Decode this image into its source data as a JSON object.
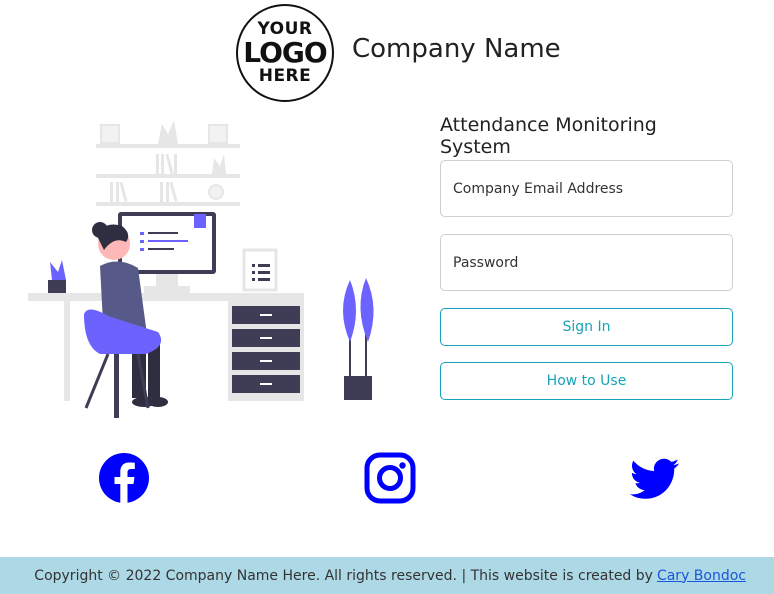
{
  "header": {
    "logo_text": [
      "YOUR",
      "LOGO",
      "HERE"
    ],
    "company_name": "Company Name"
  },
  "form": {
    "title": "Attendance Monitoring System",
    "email_placeholder": "Company Email Address",
    "password_placeholder": "Password",
    "sign_in_label": "Sign In",
    "how_to_use_label": "How to Use"
  },
  "social": {
    "icons": [
      "facebook-icon",
      "instagram-icon",
      "twitter-icon"
    ],
    "color": "#0000ff"
  },
  "footer": {
    "copyright": "Copyright © 2022 Company Name Here. All rights reserved. | This website is created by",
    "author_link": "Cary Bondoc"
  },
  "colors": {
    "accent": "#17a2b8",
    "footer_bg": "#add8e6",
    "illustration_accent": "#6c63ff"
  }
}
